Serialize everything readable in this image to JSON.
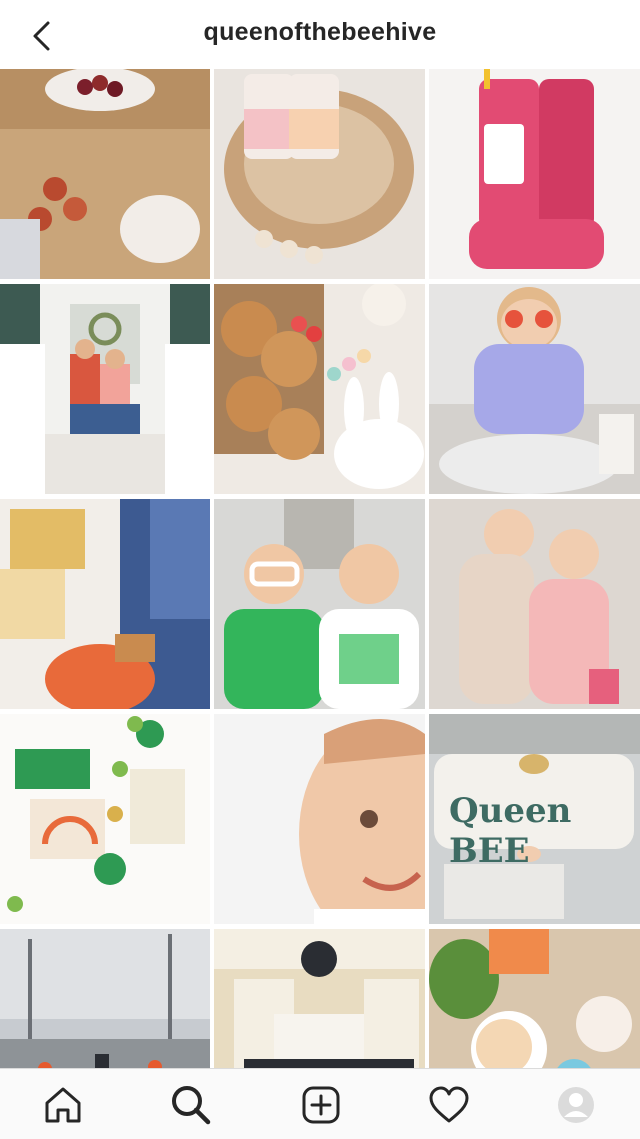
{
  "header": {
    "username": "queenofthebeehive",
    "back_icon": "chevron-left-icon"
  },
  "grid": {
    "posts": [
      {
        "name": "post-charcuterie-board",
        "colors": [
          "#c9a57a",
          "#8e2b2b",
          "#f2e6d6"
        ]
      },
      {
        "name": "post-vitamins-basket",
        "colors": [
          "#e9e4df",
          "#c8a27a",
          "#f4c2c6"
        ]
      },
      {
        "name": "post-pink-rain-boots",
        "colors": [
          "#f5f3f2",
          "#e24b73",
          "#ffffff"
        ]
      },
      {
        "name": "post-family-on-porch",
        "colors": [
          "#3d5a52",
          "#ffffff",
          "#d9573f"
        ]
      },
      {
        "name": "post-easter-pancakes",
        "colors": [
          "#efeae4",
          "#c98b4f",
          "#e95050"
        ]
      },
      {
        "name": "post-girl-heart-glasses",
        "colors": [
          "#e6e5e4",
          "#a6a8e8",
          "#e3b98b"
        ]
      },
      {
        "name": "post-bobos-bars",
        "colors": [
          "#f2eee9",
          "#3d5a91",
          "#e3bc66"
        ]
      },
      {
        "name": "post-kids-st-patricks",
        "colors": [
          "#d8d8d6",
          "#33b55b",
          "#ffffff"
        ]
      },
      {
        "name": "post-kids-pajamas",
        "colors": [
          "#ddd7d1",
          "#e7d5c6",
          "#f4b8b8"
        ]
      },
      {
        "name": "post-cam-shamrock-craft",
        "colors": [
          "#fbfaf8",
          "#2e9a53",
          "#d9b9a4"
        ]
      },
      {
        "name": "post-boy-smiling",
        "colors": [
          "#f4f4f4",
          "#f0c8a8",
          "#d9a078"
        ]
      },
      {
        "name": "post-queen-bee-sign",
        "colors": [
          "#cfd2d3",
          "#f3f1ec",
          "#3e6b63"
        ]
      },
      {
        "name": "post-kids-biking-street",
        "colors": [
          "#c7cbd0",
          "#6b6f75",
          "#e65a2e"
        ]
      },
      {
        "name": "post-dining-room",
        "colors": [
          "#e8dcc1",
          "#2a2d33",
          "#f4efe3"
        ]
      },
      {
        "name": "post-easter-table",
        "colors": [
          "#d9c6ad",
          "#5a8f3b",
          "#f1d0e5"
        ]
      }
    ]
  },
  "nav": {
    "items": [
      {
        "name": "home-icon"
      },
      {
        "name": "search-icon",
        "active": true
      },
      {
        "name": "new-post-icon"
      },
      {
        "name": "heart-icon"
      },
      {
        "name": "profile-avatar-icon"
      }
    ]
  }
}
